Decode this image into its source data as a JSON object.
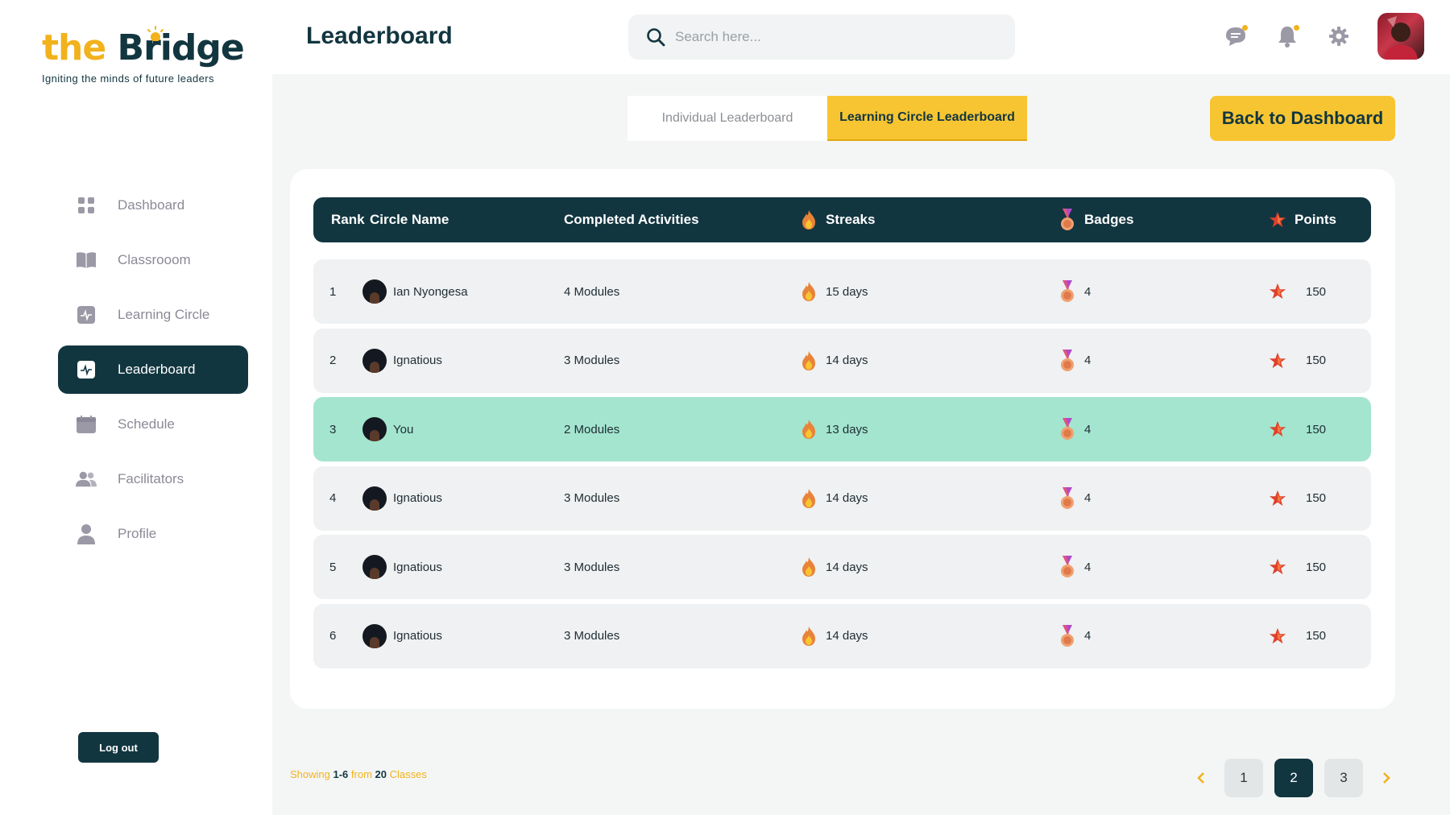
{
  "logo": {
    "part1": "the",
    "part2": "Bridge",
    "tagline": "Igniting the minds of future leaders"
  },
  "nav": [
    {
      "label": "Dashboard",
      "icon": "grid-icon"
    },
    {
      "label": "Classrooom",
      "icon": "book-icon"
    },
    {
      "label": "Learning Circle",
      "icon": "pulse-icon"
    },
    {
      "label": "Leaderboard",
      "icon": "pulse-icon",
      "active": true
    },
    {
      "label": "Schedule",
      "icon": "calendar-icon"
    },
    {
      "label": "Facilitators",
      "icon": "users-icon"
    },
    {
      "label": "Profile",
      "icon": "user-icon"
    }
  ],
  "logout_label": "Log out",
  "header": {
    "title": "Leaderboard",
    "search_placeholder": "Search here..."
  },
  "tabs": [
    {
      "label": "Individual Leaderboard",
      "active": false
    },
    {
      "label": "Learning Circle Leaderboard",
      "active": true
    }
  ],
  "back_button": "Back  to Dashboard",
  "table": {
    "headers": {
      "rank": "Rank",
      "name": "Circle Name",
      "activities": "Completed Activities",
      "streaks": "Streaks",
      "badges": "Badges",
      "points": "Points"
    },
    "rows": [
      {
        "rank": "1",
        "name": "Ian Nyongesa",
        "activities": "4 Modules",
        "streak": "15 days",
        "badges": "4",
        "points": "150"
      },
      {
        "rank": "2",
        "name": "Ignatious",
        "activities": "3 Modules",
        "streak": "14 days",
        "badges": "4",
        "points": "150"
      },
      {
        "rank": "3",
        "name": "You",
        "activities": "2 Modules",
        "streak": "13 days",
        "badges": "4",
        "points": "150",
        "highlight": true
      },
      {
        "rank": "4",
        "name": "Ignatious",
        "activities": "3 Modules",
        "streak": "14 days",
        "badges": "4",
        "points": "150"
      },
      {
        "rank": "5",
        "name": "Ignatious",
        "activities": "3 Modules",
        "streak": "14 days",
        "badges": "4",
        "points": "150"
      },
      {
        "rank": "6",
        "name": "Ignatious",
        "activities": "3 Modules",
        "streak": "14 days",
        "badges": "4",
        "points": "150"
      }
    ]
  },
  "footer": {
    "showing": "Showing",
    "range": "1-6",
    "from": "from",
    "total": "20",
    "unit": "Classes"
  },
  "pagination": {
    "pages": [
      "1",
      "2",
      "3"
    ],
    "current": "2"
  },
  "colors": {
    "primary": "#123640",
    "accent": "#f7c531",
    "highlight_row": "#a4e5cf"
  }
}
